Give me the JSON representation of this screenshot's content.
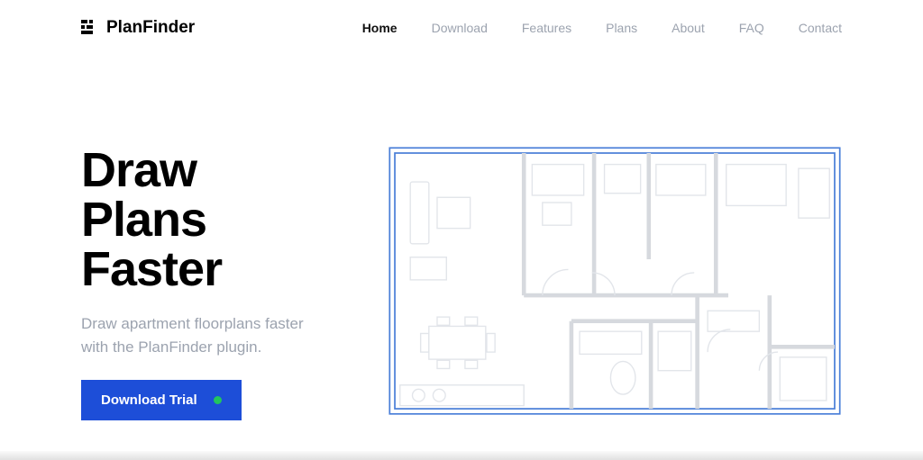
{
  "brand": {
    "name": "PlanFinder"
  },
  "nav": {
    "items": [
      {
        "label": "Home",
        "active": true
      },
      {
        "label": "Download",
        "active": false
      },
      {
        "label": "Features",
        "active": false
      },
      {
        "label": "Plans",
        "active": false
      },
      {
        "label": "About",
        "active": false
      },
      {
        "label": "FAQ",
        "active": false
      },
      {
        "label": "Contact",
        "active": false
      }
    ]
  },
  "hero": {
    "title_line1": "Draw",
    "title_line2": "Plans",
    "title_line3": "Faster",
    "subtitle": "Draw apartment floorplans faster with the PlanFinder plugin.",
    "cta_label": "Download Trial"
  },
  "colors": {
    "accent": "#1d4ed8",
    "status_dot": "#22c55e",
    "muted": "#9ca3af"
  }
}
